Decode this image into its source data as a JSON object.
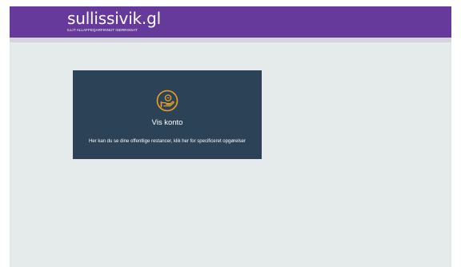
{
  "header": {
    "logo_title": "sullissivik.gl",
    "logo_subtitle": "ILLIT ALLAFFEQARFINNUT ISERRISSAT"
  },
  "card": {
    "icon": "hand-coin-icon",
    "title": "Vis konto",
    "description": "Her kan du se dine offentlige restancer, klik her for specificeret opgørelser"
  },
  "colors": {
    "header_bg": "#663a9a",
    "page_bg": "#e5eaea",
    "card_bg": "#2c4257",
    "icon_accent": "#f0a020"
  }
}
